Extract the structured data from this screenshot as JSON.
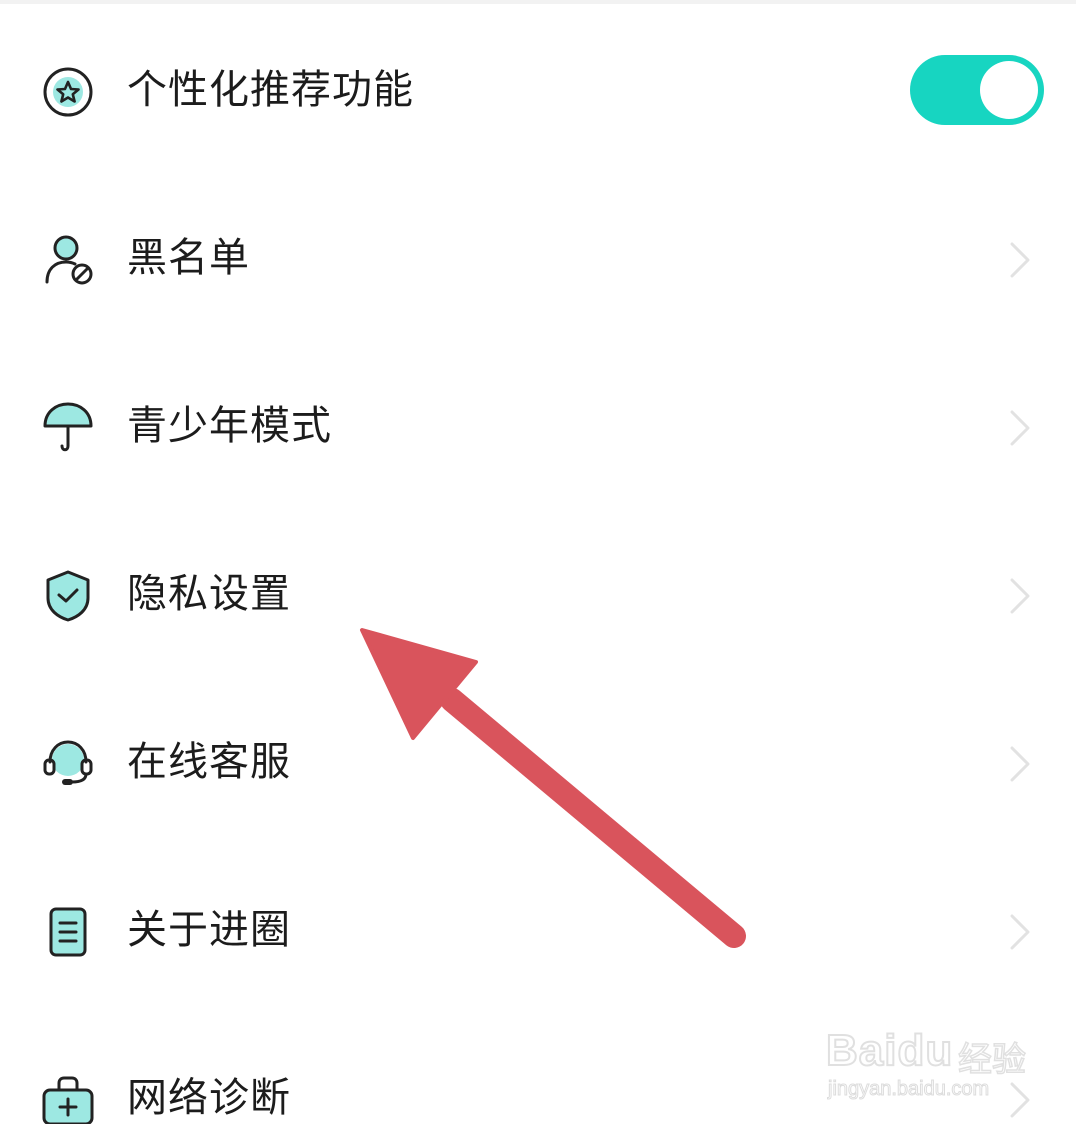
{
  "settings": {
    "items": [
      {
        "label": "个性化推荐功能",
        "icon": "star-badge-icon",
        "control": "toggle",
        "toggle_on": true
      },
      {
        "label": "黑名单",
        "icon": "user-blocked-icon",
        "control": "chevron"
      },
      {
        "label": "青少年模式",
        "icon": "umbrella-icon",
        "control": "chevron"
      },
      {
        "label": "隐私设置",
        "icon": "shield-check-icon",
        "control": "chevron"
      },
      {
        "label": "在线客服",
        "icon": "headset-icon",
        "control": "chevron"
      },
      {
        "label": "关于进圈",
        "icon": "document-icon",
        "control": "chevron"
      },
      {
        "label": "网络诊断",
        "icon": "medical-kit-icon",
        "control": "chevron"
      }
    ]
  },
  "annotation": {
    "type": "arrow",
    "color": "#d9545c",
    "points_to": "隐私设置"
  },
  "watermark": {
    "logo": "Baidu",
    "suffix": "经验",
    "url": "jingyan.baidu.com"
  },
  "colors": {
    "accent": "#17d5c1",
    "icon_fill": "#9de8e2",
    "icon_stroke": "#222222",
    "text": "#1c1c1c",
    "chevron": "#e2e2e2"
  }
}
